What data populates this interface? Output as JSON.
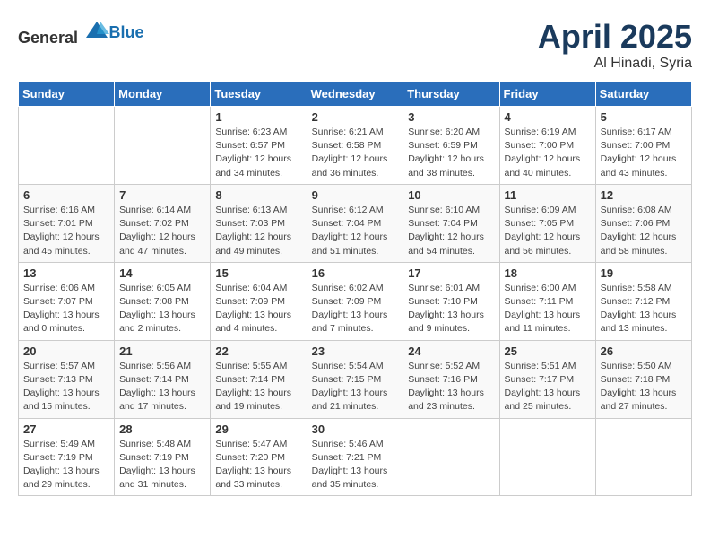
{
  "header": {
    "logo_general": "General",
    "logo_blue": "Blue",
    "month": "April 2025",
    "location": "Al Hinadi, Syria"
  },
  "weekdays": [
    "Sunday",
    "Monday",
    "Tuesday",
    "Wednesday",
    "Thursday",
    "Friday",
    "Saturday"
  ],
  "weeks": [
    [
      {
        "day": "",
        "info": ""
      },
      {
        "day": "",
        "info": ""
      },
      {
        "day": "1",
        "info": "Sunrise: 6:23 AM\nSunset: 6:57 PM\nDaylight: 12 hours and 34 minutes."
      },
      {
        "day": "2",
        "info": "Sunrise: 6:21 AM\nSunset: 6:58 PM\nDaylight: 12 hours and 36 minutes."
      },
      {
        "day": "3",
        "info": "Sunrise: 6:20 AM\nSunset: 6:59 PM\nDaylight: 12 hours and 38 minutes."
      },
      {
        "day": "4",
        "info": "Sunrise: 6:19 AM\nSunset: 7:00 PM\nDaylight: 12 hours and 40 minutes."
      },
      {
        "day": "5",
        "info": "Sunrise: 6:17 AM\nSunset: 7:00 PM\nDaylight: 12 hours and 43 minutes."
      }
    ],
    [
      {
        "day": "6",
        "info": "Sunrise: 6:16 AM\nSunset: 7:01 PM\nDaylight: 12 hours and 45 minutes."
      },
      {
        "day": "7",
        "info": "Sunrise: 6:14 AM\nSunset: 7:02 PM\nDaylight: 12 hours and 47 minutes."
      },
      {
        "day": "8",
        "info": "Sunrise: 6:13 AM\nSunset: 7:03 PM\nDaylight: 12 hours and 49 minutes."
      },
      {
        "day": "9",
        "info": "Sunrise: 6:12 AM\nSunset: 7:04 PM\nDaylight: 12 hours and 51 minutes."
      },
      {
        "day": "10",
        "info": "Sunrise: 6:10 AM\nSunset: 7:04 PM\nDaylight: 12 hours and 54 minutes."
      },
      {
        "day": "11",
        "info": "Sunrise: 6:09 AM\nSunset: 7:05 PM\nDaylight: 12 hours and 56 minutes."
      },
      {
        "day": "12",
        "info": "Sunrise: 6:08 AM\nSunset: 7:06 PM\nDaylight: 12 hours and 58 minutes."
      }
    ],
    [
      {
        "day": "13",
        "info": "Sunrise: 6:06 AM\nSunset: 7:07 PM\nDaylight: 13 hours and 0 minutes."
      },
      {
        "day": "14",
        "info": "Sunrise: 6:05 AM\nSunset: 7:08 PM\nDaylight: 13 hours and 2 minutes."
      },
      {
        "day": "15",
        "info": "Sunrise: 6:04 AM\nSunset: 7:09 PM\nDaylight: 13 hours and 4 minutes."
      },
      {
        "day": "16",
        "info": "Sunrise: 6:02 AM\nSunset: 7:09 PM\nDaylight: 13 hours and 7 minutes."
      },
      {
        "day": "17",
        "info": "Sunrise: 6:01 AM\nSunset: 7:10 PM\nDaylight: 13 hours and 9 minutes."
      },
      {
        "day": "18",
        "info": "Sunrise: 6:00 AM\nSunset: 7:11 PM\nDaylight: 13 hours and 11 minutes."
      },
      {
        "day": "19",
        "info": "Sunrise: 5:58 AM\nSunset: 7:12 PM\nDaylight: 13 hours and 13 minutes."
      }
    ],
    [
      {
        "day": "20",
        "info": "Sunrise: 5:57 AM\nSunset: 7:13 PM\nDaylight: 13 hours and 15 minutes."
      },
      {
        "day": "21",
        "info": "Sunrise: 5:56 AM\nSunset: 7:14 PM\nDaylight: 13 hours and 17 minutes."
      },
      {
        "day": "22",
        "info": "Sunrise: 5:55 AM\nSunset: 7:14 PM\nDaylight: 13 hours and 19 minutes."
      },
      {
        "day": "23",
        "info": "Sunrise: 5:54 AM\nSunset: 7:15 PM\nDaylight: 13 hours and 21 minutes."
      },
      {
        "day": "24",
        "info": "Sunrise: 5:52 AM\nSunset: 7:16 PM\nDaylight: 13 hours and 23 minutes."
      },
      {
        "day": "25",
        "info": "Sunrise: 5:51 AM\nSunset: 7:17 PM\nDaylight: 13 hours and 25 minutes."
      },
      {
        "day": "26",
        "info": "Sunrise: 5:50 AM\nSunset: 7:18 PM\nDaylight: 13 hours and 27 minutes."
      }
    ],
    [
      {
        "day": "27",
        "info": "Sunrise: 5:49 AM\nSunset: 7:19 PM\nDaylight: 13 hours and 29 minutes."
      },
      {
        "day": "28",
        "info": "Sunrise: 5:48 AM\nSunset: 7:19 PM\nDaylight: 13 hours and 31 minutes."
      },
      {
        "day": "29",
        "info": "Sunrise: 5:47 AM\nSunset: 7:20 PM\nDaylight: 13 hours and 33 minutes."
      },
      {
        "day": "30",
        "info": "Sunrise: 5:46 AM\nSunset: 7:21 PM\nDaylight: 13 hours and 35 minutes."
      },
      {
        "day": "",
        "info": ""
      },
      {
        "day": "",
        "info": ""
      },
      {
        "day": "",
        "info": ""
      }
    ]
  ]
}
